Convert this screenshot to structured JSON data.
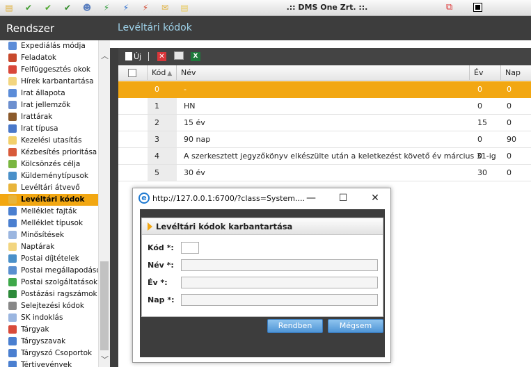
{
  "app": {
    "title": ".:: DMS One Zrt. ::."
  },
  "toolbar_icons": [
    {
      "name": "note-icon",
      "glyph": "▤",
      "color": "#e0b13c"
    },
    {
      "name": "check-green-icon",
      "glyph": "✔",
      "color": "#3b9b2a"
    },
    {
      "name": "double-check-icon",
      "glyph": "✔",
      "color": "#4fa82e"
    },
    {
      "name": "check-box-icon",
      "glyph": "✔",
      "color": "#2d8a25"
    },
    {
      "name": "user-icon",
      "glyph": "☻",
      "color": "#5b7fbf"
    },
    {
      "name": "bolt-green-icon",
      "glyph": "⚡",
      "color": "#2e9a3a"
    },
    {
      "name": "bolt-blue-icon",
      "glyph": "⚡",
      "color": "#2f6fcf"
    },
    {
      "name": "bolt-red-icon",
      "glyph": "⚡",
      "color": "#d2432c"
    },
    {
      "name": "mail-icon",
      "glyph": "✉",
      "color": "#e0b13c"
    },
    {
      "name": "document-icon",
      "glyph": "▤",
      "color": "#e8c95a"
    }
  ],
  "sidebar": {
    "title": "Rendszer",
    "items": [
      {
        "label": "Expediálás módja",
        "icon_color": "#5b8cd8"
      },
      {
        "label": "Feladatok",
        "icon_color": "#c8492d"
      },
      {
        "label": "Felfüggesztés okok",
        "icon_color": "#d9473a"
      },
      {
        "label": "Hírek karbantartása",
        "icon_color": "#f2d580"
      },
      {
        "label": "Irat állapota",
        "icon_color": "#5b8cd8"
      },
      {
        "label": "Irat jellemzők",
        "icon_color": "#6c8fcf"
      },
      {
        "label": "Irattárak",
        "icon_color": "#8b5a2b"
      },
      {
        "label": "Irat típusa",
        "icon_color": "#4a78c9"
      },
      {
        "label": "Kezelési utasítás",
        "icon_color": "#f2d06b"
      },
      {
        "label": "Kézbesítés prioritása",
        "icon_color": "#d85a3a"
      },
      {
        "label": "Kölcsönzés célja",
        "icon_color": "#7ab640"
      },
      {
        "label": "Küldeménytípusok",
        "icon_color": "#4a90c9"
      },
      {
        "label": "Levéltári átvevő",
        "icon_color": "#e8b43a"
      },
      {
        "label": "Levéltári kódok",
        "icon_color": "#e8b43a",
        "active": true
      },
      {
        "label": "Melléklet fajták",
        "icon_color": "#4a7fd0"
      },
      {
        "label": "Melléklet típusok",
        "icon_color": "#4a7fd0"
      },
      {
        "label": "Minősítések",
        "icon_color": "#9bb6e0"
      },
      {
        "label": "Naptárak",
        "icon_color": "#f2d580"
      },
      {
        "label": "Postai díjtételek",
        "icon_color": "#4a90c9"
      },
      {
        "label": "Postai megállapodások",
        "icon_color": "#5a8fd0"
      },
      {
        "label": "Postai szolgáltatások",
        "icon_color": "#3ea84a"
      },
      {
        "label": "Postázási ragszámok",
        "icon_color": "#2d8a3a"
      },
      {
        "label": "Selejtezési kódok",
        "icon_color": "#888888"
      },
      {
        "label": "SK indoklás",
        "icon_color": "#9bb6e0"
      },
      {
        "label": "Tárgyak",
        "icon_color": "#d84a3a"
      },
      {
        "label": "Tárgyszavak",
        "icon_color": "#4a7fd0"
      },
      {
        "label": "Tárgyszó Csoportok",
        "icon_color": "#4a7fd0"
      },
      {
        "label": "Tértivevények",
        "icon_color": "#4a7fd0"
      }
    ]
  },
  "main": {
    "title": "Levéltári kódok",
    "toolbar": {
      "new_label": "Új"
    },
    "columns": {
      "kod": "Kód",
      "nev": "Név",
      "ev": "Év",
      "nap": "Nap"
    },
    "rows": [
      {
        "kod": "0",
        "nev": "-",
        "ev": "0",
        "nap": "0",
        "selected": true
      },
      {
        "kod": "1",
        "nev": "HN",
        "ev": "0",
        "nap": "0"
      },
      {
        "kod": "2",
        "nev": "15 év",
        "ev": "15",
        "nap": "0"
      },
      {
        "kod": "3",
        "nev": "90 nap",
        "ev": "0",
        "nap": "90"
      },
      {
        "kod": "4",
        "nev": "A szerkesztett jegyzőkönyv elkészülte után a keletkezést követő év március 31-ig",
        "ev": "0",
        "nap": "0"
      },
      {
        "kod": "5",
        "nev": "30 év",
        "ev": "30",
        "nap": "0"
      }
    ]
  },
  "dialog": {
    "url": "http://127.0.0.1:6700/?class=System....",
    "form_title": "Levéltári kódok karbantartása",
    "labels": {
      "kod": "Kód *:",
      "nev": "Név *:",
      "ev": "Év *:",
      "nap": "Nap *:"
    },
    "values": {
      "kod": "",
      "nev": "",
      "ev": "",
      "nap": ""
    },
    "ok_label": "Rendben",
    "cancel_label": "Mégsem"
  },
  "colors": {
    "accent": "#f2a712",
    "header_bg": "#3d3d3d",
    "header_text": "#9fd3ea",
    "button_blue": "#4f95d6"
  }
}
